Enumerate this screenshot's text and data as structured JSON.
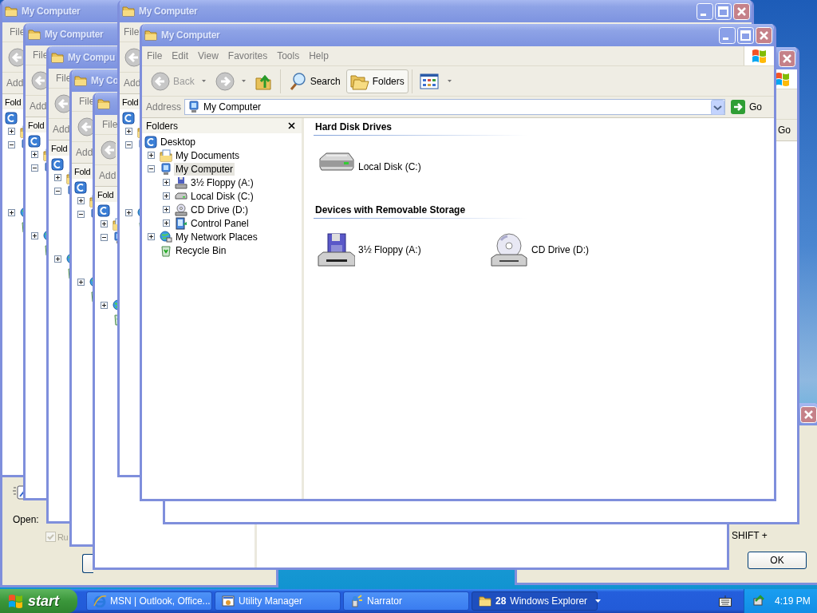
{
  "dialogs": {
    "run": {
      "open_label": "Open:",
      "checkbox": {
        "label": "Ru",
        "checked": true,
        "disabled": true
      }
    },
    "utility_manager": {
      "text": "SHIFT +",
      "ok_button": "OK"
    }
  },
  "windows": [
    {
      "kind": "stacked",
      "title": "My Computer",
      "menu": [
        "File"
      ],
      "toolbar": [
        {
          "kind": "back",
          "disabled": true
        }
      ],
      "address_label": "Add",
      "pane_title": "Fold",
      "tree": [
        {
          "kind": "desktop",
          "children": [
            {
              "kind": "documents",
              "expanded": false
            },
            {
              "kind": "computer",
              "expanded": true
            },
            {
              "kind": "network",
              "expanded": false
            },
            {
              "kind": "recycle"
            }
          ]
        }
      ]
    },
    {
      "kind": "stacked",
      "title": "My Computer",
      "menu": [
        "File"
      ],
      "toolbar": [
        {
          "kind": "back",
          "disabled": true
        }
      ],
      "address_label": "Add",
      "pane_title": "Fold",
      "tree": [
        {
          "kind": "desktop",
          "children": [
            {
              "kind": "documents",
              "expanded": false
            },
            {
              "kind": "computer",
              "expanded": true
            },
            {
              "kind": "network",
              "expanded": false
            },
            {
              "kind": "recycle"
            }
          ]
        }
      ]
    },
    {
      "kind": "stacked",
      "title": "My Compu",
      "menu": [
        "File"
      ],
      "toolbar": [
        {
          "kind": "back",
          "disabled": true
        }
      ],
      "address_label": "Add",
      "pane_title": "Fold",
      "tree": [
        {
          "kind": "desktop",
          "children": [
            {
              "kind": "documents",
              "expanded": false
            },
            {
              "kind": "computer",
              "expanded": true
            },
            {
              "kind": "network",
              "expanded": false
            },
            {
              "kind": "recycle"
            }
          ]
        }
      ]
    },
    {
      "kind": "stacked",
      "title": "My Co",
      "menu": [
        "File"
      ],
      "toolbar": [
        {
          "kind": "back",
          "disabled": true
        }
      ],
      "address_label": "Add",
      "pane_title": "Fold",
      "tree": [
        {
          "kind": "desktop",
          "children": [
            {
              "kind": "documents",
              "expanded": false
            },
            {
              "kind": "computer",
              "expanded": true
            },
            {
              "kind": "network",
              "expanded": false
            },
            {
              "kind": "recycle"
            }
          ]
        }
      ]
    },
    {
      "kind": "stacked",
      "menu": [
        "File"
      ],
      "toolbar": [
        {
          "kind": "back",
          "disabled": true
        }
      ],
      "address_label": "Add",
      "pane_title": "Fold",
      "tree": [
        {
          "kind": "desktop",
          "children": [
            {
              "kind": "documents",
              "expanded": false
            },
            {
              "kind": "computer",
              "expanded": true
            },
            {
              "kind": "network",
              "expanded": false
            },
            {
              "kind": "recycle"
            }
          ]
        }
      ]
    },
    {
      "kind": "stacked",
      "title": "My Computer",
      "has_controls": true,
      "menu": [
        "File"
      ],
      "toolbar": [
        {
          "kind": "back",
          "disabled": true
        }
      ],
      "address_label": "Add",
      "pane_title": "Fold",
      "tree": [
        {
          "kind": "desktop",
          "children": [
            {
              "kind": "documents",
              "expanded": false
            },
            {
              "kind": "computer",
              "expanded": true
            },
            {
              "kind": "network",
              "expanded": false
            },
            {
              "kind": "recycle"
            }
          ]
        }
      ]
    },
    {
      "kind": "edge",
      "throbber": true,
      "go_label": "Go"
    },
    {
      "kind": "main",
      "title": "My Computer",
      "has_controls": true,
      "throbber": true,
      "menu": [
        "File",
        "Edit",
        "View",
        "Favorites",
        "Tools",
        "Help"
      ],
      "toolbar": [
        {
          "kind": "back",
          "label": "Back",
          "disabled": true,
          "pressed": false
        },
        {
          "kind": "forward",
          "disabled": true,
          "pressed": false
        },
        {
          "kind": "up",
          "disabled": false,
          "pressed": false
        },
        {
          "kind": "search",
          "label": "Search",
          "disabled": false,
          "pressed": false
        },
        {
          "kind": "folders",
          "label": "Folders",
          "disabled": false,
          "pressed": true
        },
        {
          "kind": "views",
          "disabled": false,
          "pressed": false
        }
      ],
      "address_label": "Address",
      "address_value": "My Computer",
      "go_label": "Go",
      "pane_title": "Folders",
      "tree": [
        {
          "kind": "desktop",
          "label": "Desktop",
          "selected": false,
          "children": [
            {
              "kind": "documents",
              "label": "My Documents",
              "expanded": false,
              "selected": false
            },
            {
              "kind": "computer",
              "label": "My Computer",
              "expanded": true,
              "selected": true,
              "children": [
                {
                  "kind": "floppy",
                  "label": "3½ Floppy (A:)",
                  "expanded": false,
                  "selected": false
                },
                {
                  "kind": "disk",
                  "label": "Local Disk (C:)",
                  "expanded": false,
                  "selected": false
                },
                {
                  "kind": "cd",
                  "label": "CD Drive (D:)",
                  "expanded": false,
                  "selected": false
                },
                {
                  "kind": "control-panel",
                  "label": "Control Panel",
                  "expanded": false,
                  "selected": false
                }
              ]
            },
            {
              "kind": "network",
              "label": "My Network Places",
              "expanded": false,
              "selected": false
            },
            {
              "kind": "recycle",
              "label": "Recycle Bin",
              "selected": false
            }
          ]
        }
      ],
      "sections": [
        {
          "title": "Hard Disk Drives",
          "items": [
            {
              "kind": "disk",
              "label": "Local Disk (C:)"
            }
          ]
        },
        {
          "title": "Devices with Removable Storage",
          "items": [
            {
              "kind": "floppy",
              "label": "3½ Floppy (A:)"
            },
            {
              "kind": "cd",
              "label": "CD Drive (D:)"
            }
          ]
        }
      ]
    }
  ],
  "taskbar": {
    "start_label": "start",
    "tasks": [
      {
        "kind": "browser",
        "label": "MSN | Outlook, Office...",
        "selected": false
      },
      {
        "kind": "utility",
        "label": "Utility Manager",
        "selected": false
      },
      {
        "kind": "narrator",
        "label": "Narrator",
        "selected": false
      },
      {
        "kind": "folder-group",
        "count": "28",
        "label": "Windows Explorer",
        "selected": true
      }
    ],
    "clock": "4:19 PM"
  }
}
